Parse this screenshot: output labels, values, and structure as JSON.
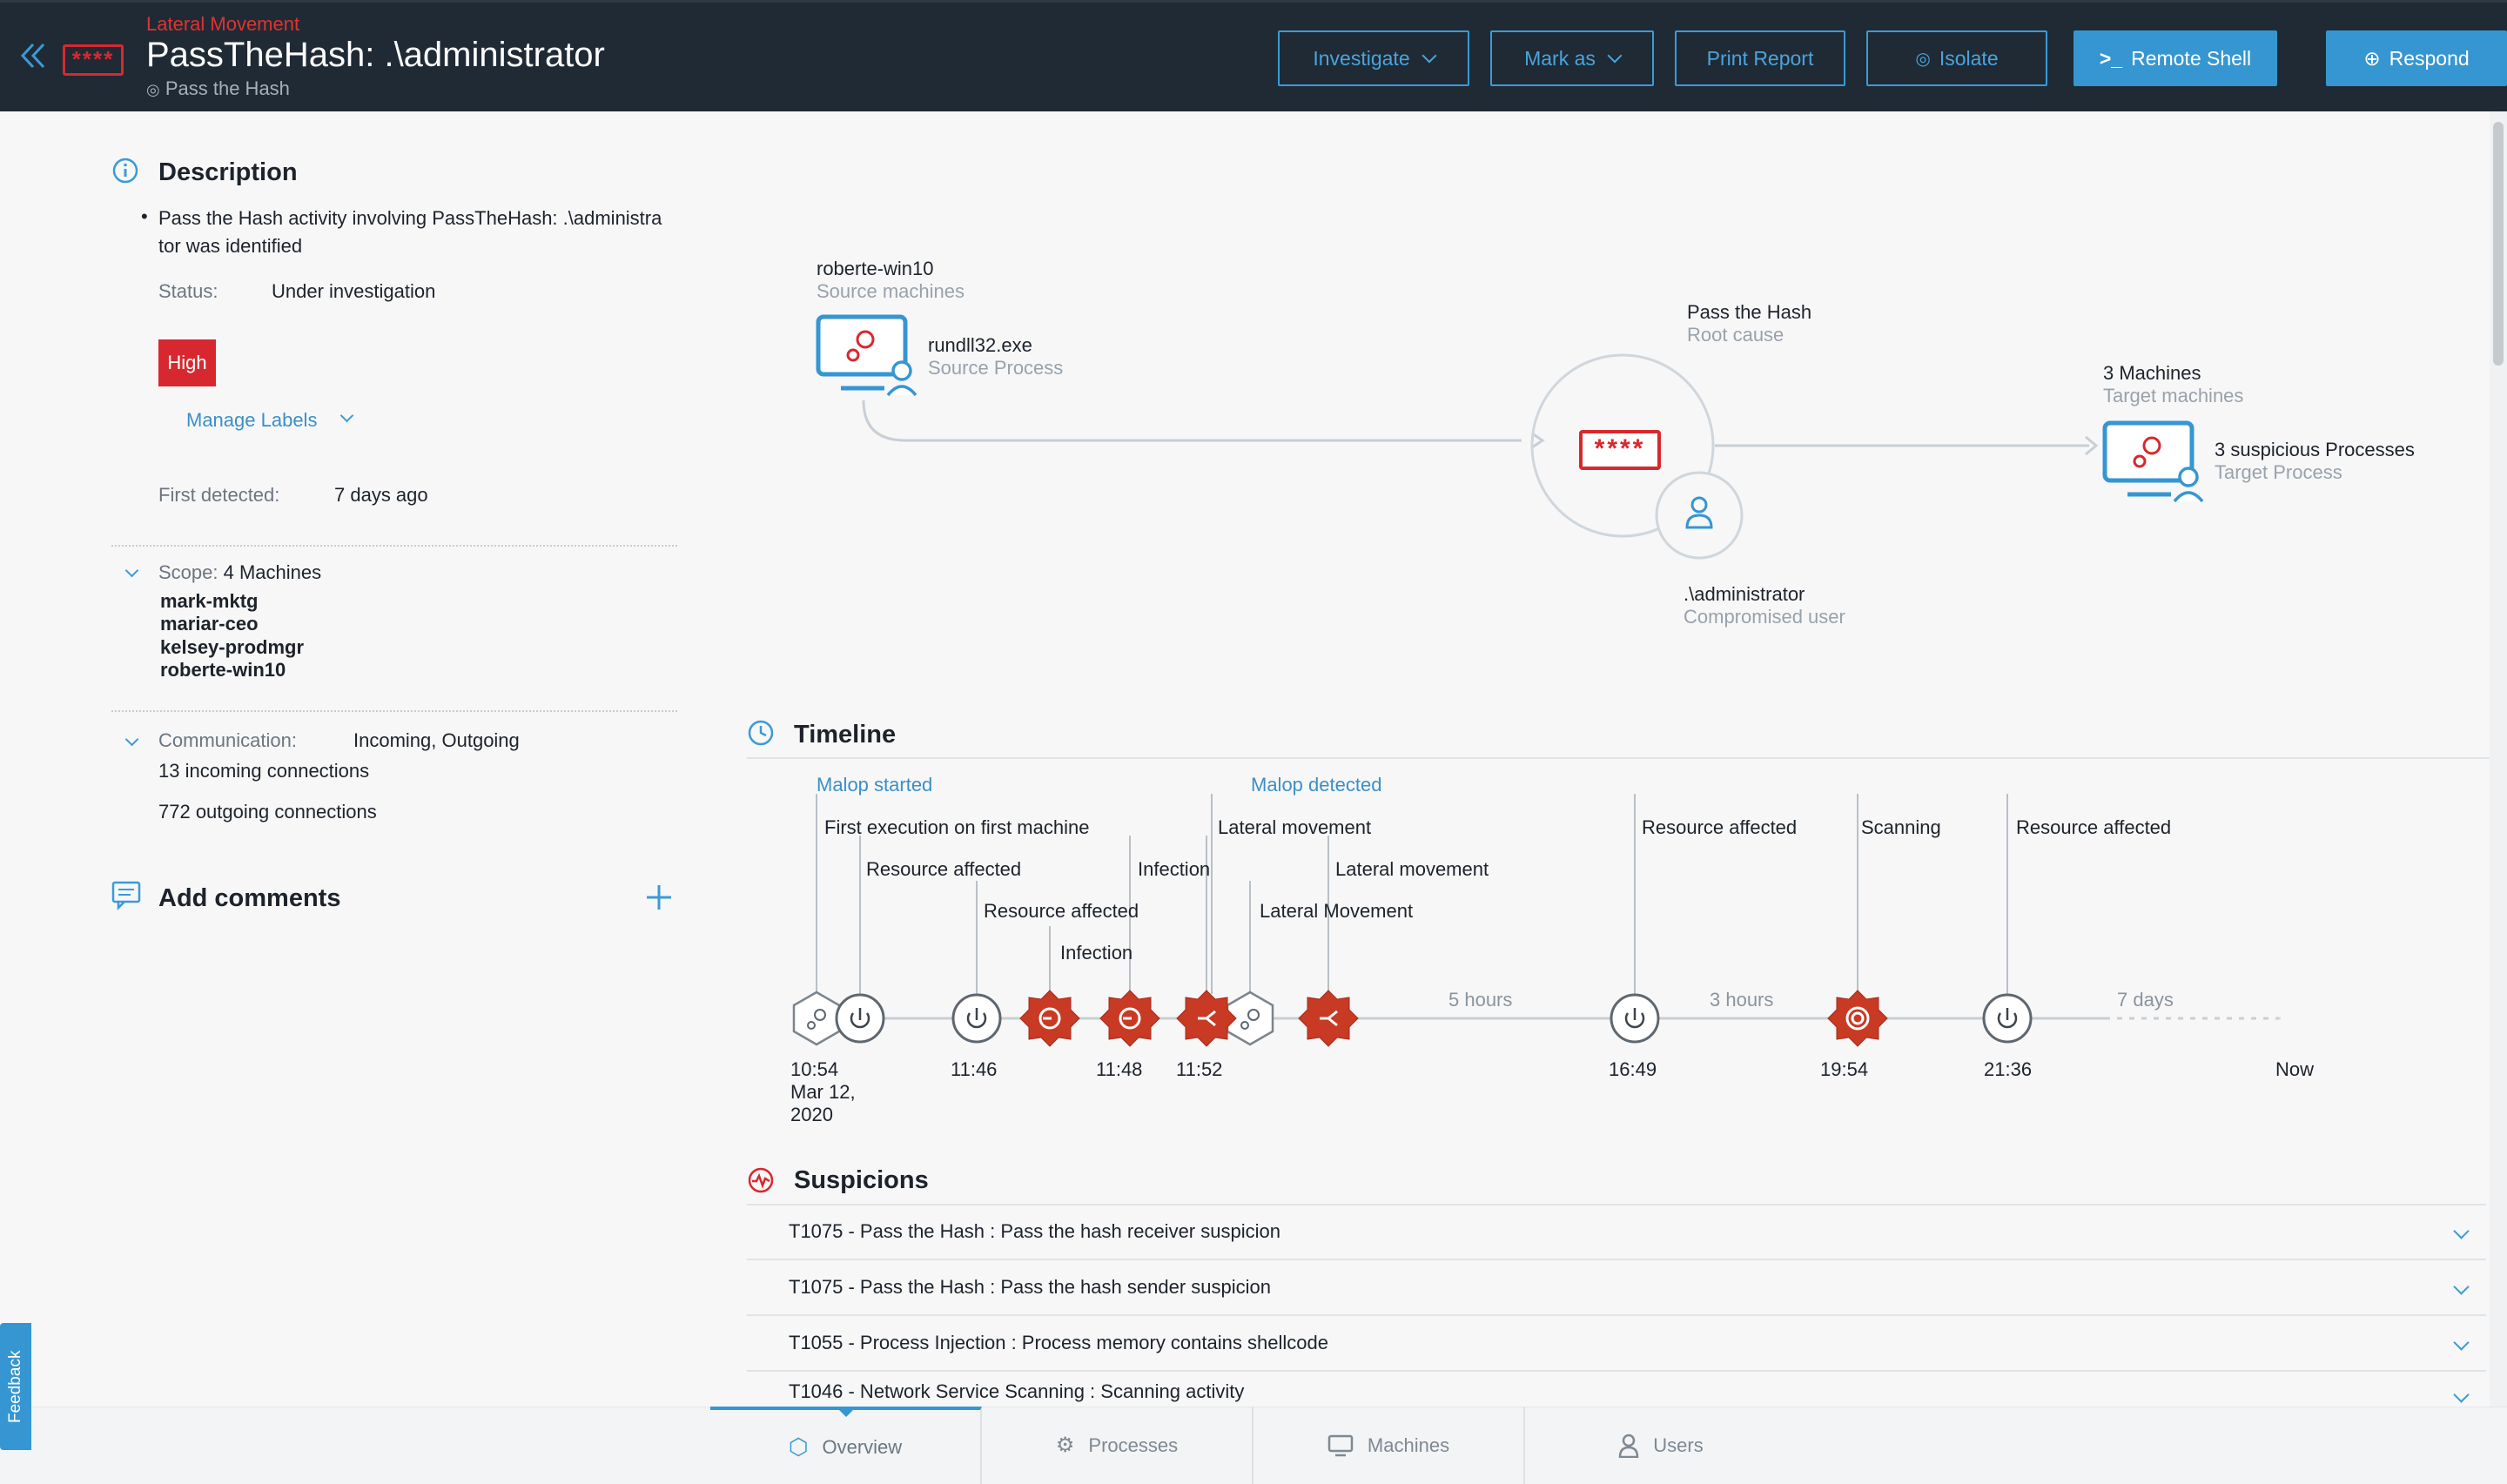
{
  "header": {
    "subtitle": "Lateral Movement",
    "title": "PassTheHash: .\\administrator",
    "root_cause": "Pass the Hash",
    "logo_text": "****",
    "buttons": {
      "investigate": "Investigate",
      "mark_as": "Mark as",
      "print_report": "Print Report",
      "isolate": "Isolate",
      "remote_shell": "Remote Shell",
      "respond": "Respond"
    },
    "colors": {
      "bg": "#1f2a35",
      "accent": "#3596d2",
      "alert": "#d8282f"
    }
  },
  "description": {
    "title": "Description",
    "bullet_line1": "Pass the Hash activity involving PassTheHash: .\\administra",
    "bullet_line2": "tor was identified",
    "status_label": "Status:",
    "status_value": "Under investigation",
    "severity": "High",
    "manage_labels": "Manage Labels",
    "first_detected_label": "First detected:",
    "first_detected_value": "7 days ago"
  },
  "scope": {
    "label": "Scope:",
    "value": "4 Machines",
    "machines": [
      "mark-mktg",
      "mariar-ceo",
      "kelsey-prodmgr",
      "roberte-win10"
    ]
  },
  "communication": {
    "label": "Communication:",
    "value": "Incoming, Outgoing",
    "incoming": "13 incoming connections",
    "outgoing": "772 outgoing connections"
  },
  "comments": {
    "title": "Add comments"
  },
  "graph": {
    "source_machine": "roberte-win10",
    "source_machine_sub": "Source machines",
    "source_process": "rundll32.exe",
    "source_process_sub": "Source Process",
    "root_cause": "Pass the Hash",
    "root_cause_sub": "Root cause",
    "hash_text": "****",
    "target_machines": "3 Machines",
    "target_machines_sub": "Target machines",
    "target_process": "3 suspicious Processes",
    "target_process_sub": "Target Process",
    "user": ".\\administrator",
    "user_sub": "Compromised user"
  },
  "timeline": {
    "title": "Timeline",
    "malop_started": "Malop started",
    "malop_detected": "Malop detected",
    "events": {
      "first_exec": "First execution on first machine",
      "res1": "Resource affected",
      "res2": "Resource affected",
      "infection1": "Infection",
      "infection2": "Infection",
      "lateral1": "Lateral movement",
      "lateral2": "Lateral movement",
      "lateral3": "Lateral Movement",
      "res3": "Resource affected",
      "scanning": "Scanning",
      "res4": "Resource affected"
    },
    "gaps": {
      "g1": "5 hours",
      "g2": "3 hours",
      "g3": "7 days"
    },
    "times": {
      "t1": "10:54",
      "t1_date1": "Mar 12,",
      "t1_date2": "2020",
      "t2": "11:46",
      "t3": "11:48",
      "t4": "11:52",
      "t5": "16:49",
      "t6": "19:54",
      "t7": "21:36",
      "now": "Now"
    }
  },
  "suspicions": {
    "title": "Suspicions",
    "items": [
      "T1075 - Pass the Hash : Pass the hash receiver suspicion",
      "T1075 - Pass the Hash : Pass the hash sender suspicion",
      "T1055 - Process Injection : Process memory contains shellcode",
      "T1046 - Network Service Scanning : Scanning activity"
    ]
  },
  "tabs": [
    "Overview",
    "Processes",
    "Machines",
    "Users"
  ],
  "feedback": "Feedback"
}
